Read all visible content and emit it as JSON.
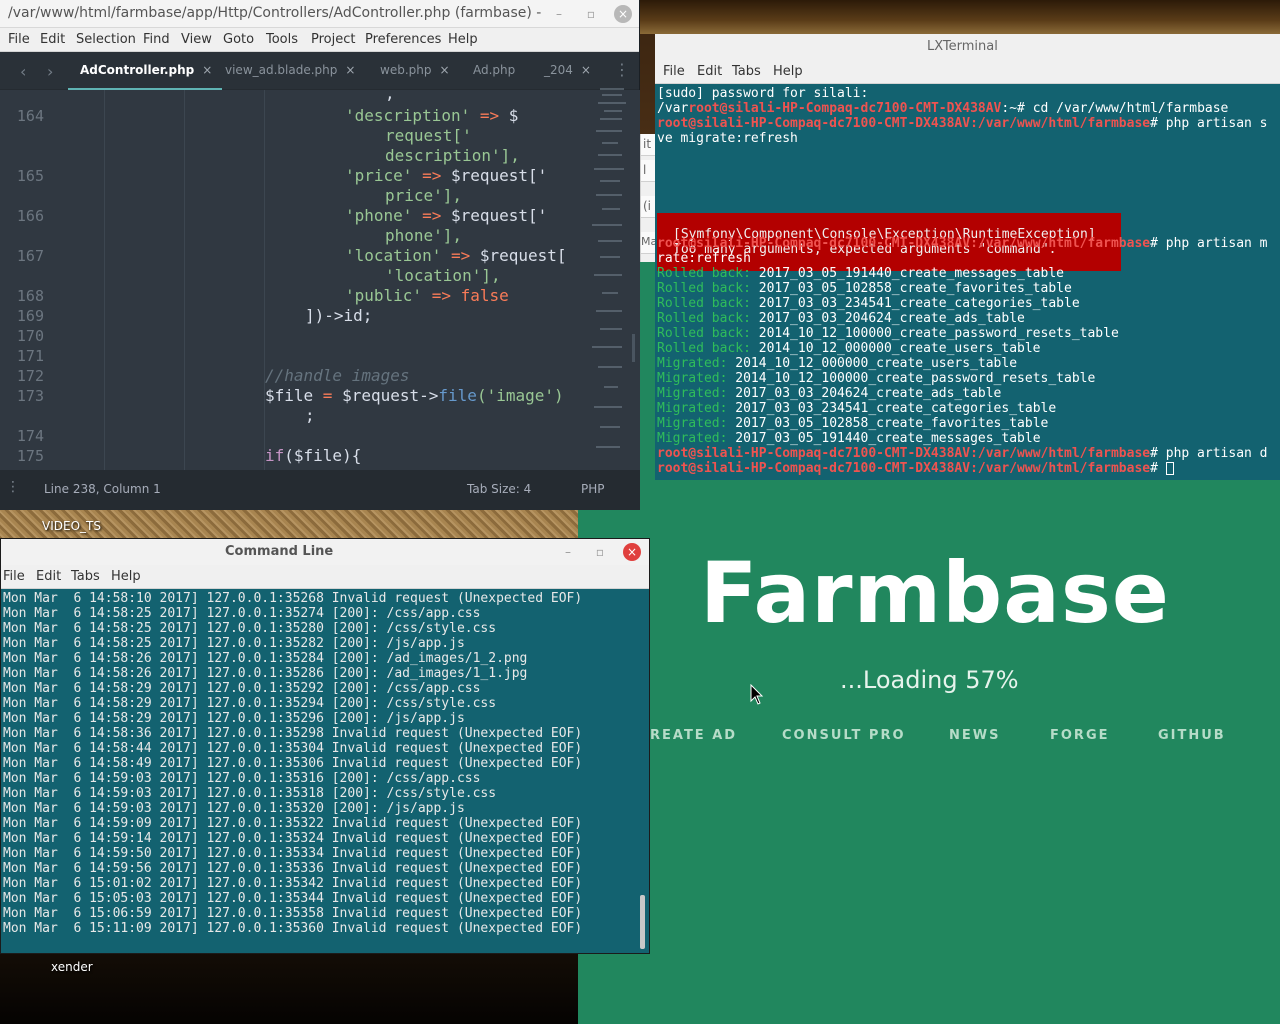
{
  "desktop": {
    "label_video": "VIDEO_TS",
    "label_xender": "xender"
  },
  "sublime": {
    "title": "/var/www/html/farmbase/app/Http/Controllers/AdController.php (farmbase) - ",
    "menu": [
      "File",
      "Edit",
      "Selection",
      "Find",
      "View",
      "Goto",
      "Tools",
      "Project",
      "Preferences",
      "Help"
    ],
    "tabs": [
      {
        "label": "AdController.php",
        "close": "×",
        "active": true
      },
      {
        "label": "view_ad.blade.php",
        "close": "×",
        "active": false
      },
      {
        "label": "web.php",
        "close": "×",
        "active": false
      },
      {
        "label": "Ad.php",
        "close": "×",
        "active": false
      },
      {
        "label": "_204",
        "close": "×",
        "active": false
      }
    ],
    "nav_back": "‹",
    "nav_fwd": "›",
    "tab_menu": "⋮",
    "gutter": [
      "164",
      "165",
      "166",
      "167",
      "168",
      "169",
      "170",
      "171",
      "172",
      "173",
      "174",
      "175"
    ],
    "code": {
      "l0": ",",
      "l1a": "'description'",
      "l1b": " => ",
      "l1c": "$",
      "l2": "request['",
      "l3": "description'],",
      "l4a": "'price'",
      "l4b": " => ",
      "l4c": "$request['",
      "l5": "price'],",
      "l6a": "'phone'",
      "l6b": " => ",
      "l6c": "$request['",
      "l7": "phone'],",
      "l8a": "'location'",
      "l8b": " => ",
      "l8c": "$request[",
      "l9": "'location'],",
      "l10a": "'public'",
      "l10b": " => ",
      "l10c": "false",
      "l11": "])->id;",
      "l12": "//handle images",
      "l13a": "$file",
      "l13b": " = ",
      "l13c": "$request->",
      "l13d": "file",
      "l13e": "('image')",
      "l14": ";",
      "l15a": "if",
      "l15b": "($file){"
    },
    "status": {
      "position": "Line 238, Column 1",
      "tab_size": "Tab Size: 4",
      "syntax": "PHP"
    },
    "colors": {
      "bg": "#303841",
      "string": "#99c794",
      "keyword": "#c594c5",
      "bool": "#f97b58",
      "comment": "#65737e"
    }
  },
  "lxterminal": {
    "title": "LXTerminal",
    "menu": [
      "File",
      "Edit",
      "Tabs",
      "Help"
    ],
    "lines": {
      "sudo": "[sudo] password for silali:",
      "p1_pre": "/var",
      "user": "root@silali-HP-Compaq-dc7100-CMT-DX438AV",
      "p1_path": ":~# ",
      "p1_cmd": "cd /var/www/html/farmbase",
      "path": ":/var/www/html/farmbase",
      "hash": "# ",
      "cmd2": "php artisan s",
      "cmd2b": "ve migrate:refresh",
      "err1": "[Symfony\\Component\\Console\\Exception\\RuntimeException]",
      "err2": "Too many arguments, expected arguments \"command\".",
      "cmd3": "php artisan m",
      "cmd3b": "rate:refresh",
      "cmd4": "php artisan d"
    },
    "rolled_label": "Rolled back:",
    "migrated_label": "Migrated:",
    "rolled": [
      "2017_03_05_191440_create_messages_table",
      "2017_03_05_102858_create_favorites_table",
      "2017_03_03_234541_create_categories_table",
      "2017_03_03_204624_create_ads_table",
      "2014_10_12_100000_create_password_resets_table",
      "2014_10_12_000000_create_users_table"
    ],
    "migrated": [
      "2014_10_12_000000_create_users_table",
      "2014_10_12_100000_create_password_resets_table",
      "2017_03_03_204624_create_ads_table",
      "2017_03_03_234541_create_categories_table",
      "2017_03_05_102858_create_favorites_table",
      "2017_03_05_191440_create_messages_table"
    ]
  },
  "cmdline": {
    "title": "Command Line",
    "menu": [
      "File",
      "Edit",
      "Tabs",
      "Help"
    ],
    "log": [
      "Mon Mar  6 14:58:10 2017] 127.0.0.1:35268 Invalid request (Unexpected EOF)",
      "Mon Mar  6 14:58:25 2017] 127.0.0.1:35274 [200]: /css/app.css",
      "Mon Mar  6 14:58:25 2017] 127.0.0.1:35280 [200]: /css/style.css",
      "Mon Mar  6 14:58:25 2017] 127.0.0.1:35282 [200]: /js/app.js",
      "Mon Mar  6 14:58:26 2017] 127.0.0.1:35284 [200]: /ad_images/1_2.png",
      "Mon Mar  6 14:58:26 2017] 127.0.0.1:35286 [200]: /ad_images/1_1.jpg",
      "Mon Mar  6 14:58:29 2017] 127.0.0.1:35292 [200]: /css/app.css",
      "Mon Mar  6 14:58:29 2017] 127.0.0.1:35294 [200]: /css/style.css",
      "Mon Mar  6 14:58:29 2017] 127.0.0.1:35296 [200]: /js/app.js",
      "Mon Mar  6 14:58:36 2017] 127.0.0.1:35298 Invalid request (Unexpected EOF)",
      "Mon Mar  6 14:58:44 2017] 127.0.0.1:35304 Invalid request (Unexpected EOF)",
      "Mon Mar  6 14:58:49 2017] 127.0.0.1:35306 Invalid request (Unexpected EOF)",
      "Mon Mar  6 14:59:03 2017] 127.0.0.1:35316 [200]: /css/app.css",
      "Mon Mar  6 14:59:03 2017] 127.0.0.1:35318 [200]: /css/style.css",
      "Mon Mar  6 14:59:03 2017] 127.0.0.1:35320 [200]: /js/app.js",
      "Mon Mar  6 14:59:09 2017] 127.0.0.1:35322 Invalid request (Unexpected EOF)",
      "Mon Mar  6 14:59:14 2017] 127.0.0.1:35324 Invalid request (Unexpected EOF)",
      "Mon Mar  6 14:59:50 2017] 127.0.0.1:35334 Invalid request (Unexpected EOF)",
      "Mon Mar  6 14:59:56 2017] 127.0.0.1:35336 Invalid request (Unexpected EOF)",
      "Mon Mar  6 15:01:02 2017] 127.0.0.1:35342 Invalid request (Unexpected EOF)",
      "Mon Mar  6 15:05:03 2017] 127.0.0.1:35344 Invalid request (Unexpected EOF)",
      "Mon Mar  6 15:06:59 2017] 127.0.0.1:35358 Invalid request (Unexpected EOF)",
      "Mon Mar  6 15:11:09 2017] 127.0.0.1:35360 Invalid request (Unexpected EOF)"
    ]
  },
  "farmbase": {
    "brand": "Farmbase",
    "loading": "...Loading 57%",
    "loading_progress": 57,
    "nav": [
      "REATE AD",
      "CONSULT PRO",
      "NEWS",
      "FORGE",
      "GITHUB"
    ],
    "sliver_labels": [
      "it",
      "l",
      "(i",
      "Mar"
    ],
    "bg_color": "#21875e"
  },
  "window_controls": {
    "minimize": "–",
    "maximize": "▫",
    "close": "×"
  }
}
